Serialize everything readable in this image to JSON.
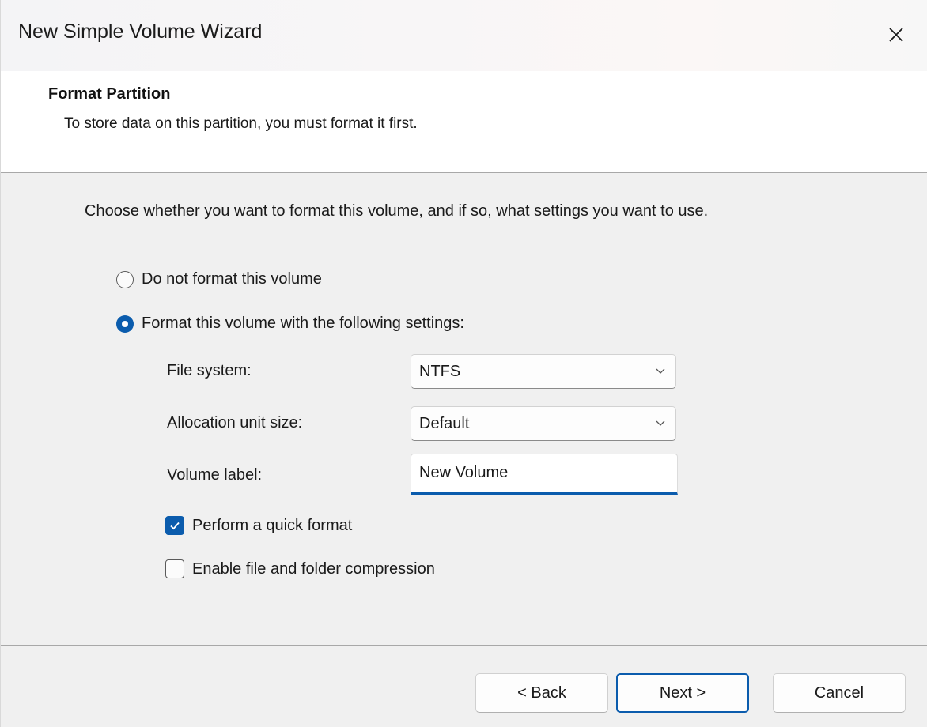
{
  "window": {
    "title": "New Simple Volume Wizard"
  },
  "header": {
    "title": "Format Partition",
    "subtitle": "To store data on this partition, you must format it first."
  },
  "body": {
    "intro": "Choose whether you want to format this volume, and if so, what settings you want to use.",
    "options": {
      "no_format": {
        "label": "Do not format this volume",
        "selected": false
      },
      "format": {
        "label": "Format this volume with the following settings:",
        "selected": true
      }
    },
    "fields": {
      "file_system": {
        "label": "File system:",
        "value": "NTFS"
      },
      "allocation_unit": {
        "label": "Allocation unit size:",
        "value": "Default"
      },
      "volume_label": {
        "label": "Volume label:",
        "value": "New Volume"
      }
    },
    "checkboxes": {
      "quick_format": {
        "label": "Perform a quick format",
        "checked": true
      },
      "compression": {
        "label": "Enable file and folder compression",
        "checked": false
      }
    }
  },
  "footer": {
    "back": "< Back",
    "next": "Next >",
    "cancel": "Cancel"
  },
  "colors": {
    "accent": "#0b5cad",
    "dialog_bg": "#f0f0f0",
    "header_bg": "#ffffff"
  },
  "icons": {
    "close": "close-icon",
    "dropdown": "chevron-down-icon",
    "check": "checkmark-icon"
  }
}
